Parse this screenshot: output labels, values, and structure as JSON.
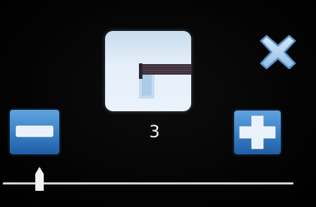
{
  "counter": {
    "value": "3"
  },
  "icons": {
    "preview": "ribbon-cable-image",
    "decrease": "minus-icon",
    "increase": "plus-icon",
    "close": "close-icon",
    "slider_thumb": "slider-thumb-icon"
  },
  "colors": {
    "background": "#030303",
    "button_blue": "#3c82c8",
    "track": "#d6d6d6",
    "text": "#f2f2f2"
  }
}
